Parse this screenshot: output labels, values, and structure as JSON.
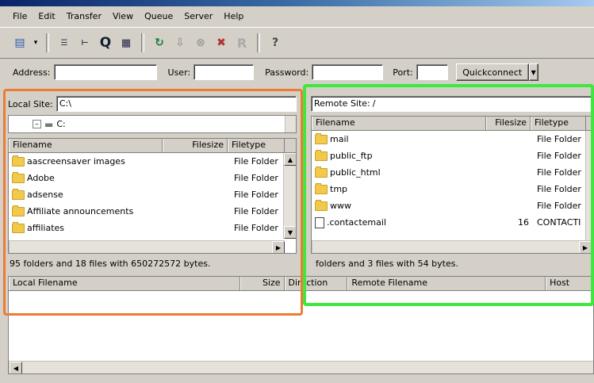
{
  "menu": [
    "File",
    "Edit",
    "Transfer",
    "View",
    "Queue",
    "Server",
    "Help"
  ],
  "toolbar": {
    "icons": [
      "site-manager-icon",
      "dropdown-arrow-icon",
      "message-log-icon",
      "local-tree-icon",
      "queue-icon",
      "remote-tree-icon",
      "refresh-icon",
      "process-queue-icon",
      "cancel-icon",
      "disconnect-icon",
      "reconnect-icon",
      "help-icon"
    ],
    "q_glyph": "Q",
    "r_glyph": "R",
    "help_glyph": "?"
  },
  "connect": {
    "address_label": "Address:",
    "user_label": "User:",
    "password_label": "Password:",
    "port_label": "Port:",
    "quickconnect_label": "Quickconnect"
  },
  "local": {
    "site_label": "Local Site:",
    "site_value": "C:\\",
    "tree_drive": "C:",
    "columns": [
      "Filename",
      "Filesize",
      "Filetype"
    ],
    "files": [
      {
        "name": "aascreensaver images",
        "size": "",
        "type": "File Folder"
      },
      {
        "name": "Adobe",
        "size": "",
        "type": "File Folder"
      },
      {
        "name": "adsense",
        "size": "",
        "type": "File Folder"
      },
      {
        "name": "Affiliate announcements",
        "size": "",
        "type": "File Folder"
      },
      {
        "name": "affiliates",
        "size": "",
        "type": "File Folder"
      }
    ],
    "status": "95 folders and 18 files with 650272572 bytes."
  },
  "remote": {
    "site_label": "Remote Site:",
    "site_value": "/",
    "columns": [
      "Filename",
      "Filesize",
      "Filetype"
    ],
    "files": [
      {
        "name": "mail",
        "size": "",
        "type": "File Folder",
        "icon": "folder"
      },
      {
        "name": "public_ftp",
        "size": "",
        "type": "File Folder",
        "icon": "folder"
      },
      {
        "name": "public_html",
        "size": "",
        "type": "File Folder",
        "icon": "folder"
      },
      {
        "name": "tmp",
        "size": "",
        "type": "File Folder",
        "icon": "folder"
      },
      {
        "name": "www",
        "size": "",
        "type": "File Folder",
        "icon": "folder"
      },
      {
        "name": ".contactemail",
        "size": "16",
        "type": "CONTACTI",
        "icon": "file"
      }
    ],
    "status": "folders and 3 files with 54 bytes."
  },
  "queue": {
    "columns": [
      "Local Filename",
      "Size",
      "Direction",
      "Remote Filename",
      "Host"
    ]
  },
  "colors": {
    "annotation_local": "#f07a32",
    "annotation_remote": "#3ee83e"
  }
}
